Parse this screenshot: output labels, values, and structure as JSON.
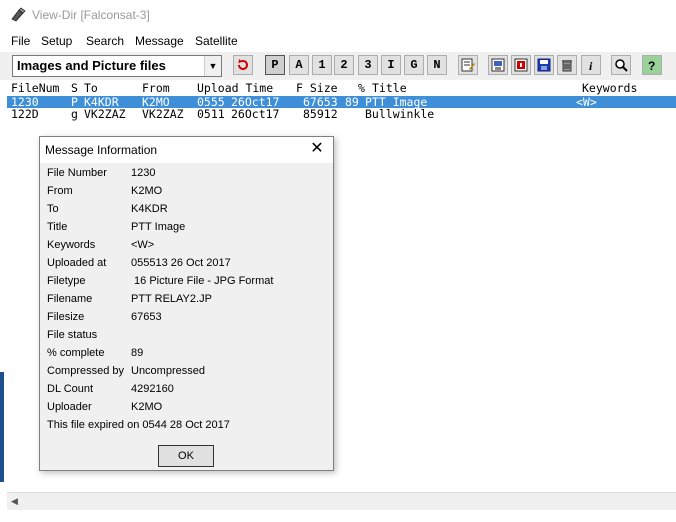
{
  "window": {
    "title": "View-Dir [Falconsat-3]"
  },
  "menu": [
    "File",
    "Setup",
    "Search",
    "Message",
    "Satellite"
  ],
  "toolbar": {
    "filter_value": "Images and Picture files",
    "letter_buttons": [
      "P",
      "A",
      "1",
      "2",
      "3",
      "I",
      "G",
      "N"
    ]
  },
  "columns": {
    "filenum": "FileNum",
    "s": "S",
    "to": "To",
    "from": "From",
    "upload_time": "Upload Time",
    "fsize": "F Size",
    "pct": "%",
    "title": "Title",
    "keywords": "Keywords"
  },
  "rows": [
    {
      "filenum": "1230",
      "s": "P",
      "to": "K4KDR",
      "from": "K2MO",
      "time": "0555",
      "date": "26Oct17",
      "size": "67653",
      "pct": "89",
      "title": "PTT Image",
      "keywords": "<W>",
      "selected": true
    },
    {
      "filenum": "122D",
      "s": "g",
      "to": "VK2ZAZ",
      "from": "VK2ZAZ",
      "time": "0511",
      "date": "26Oct17",
      "size": "85912",
      "pct": "",
      "title": "Bullwinkle",
      "keywords": "",
      "selected": false
    }
  ],
  "dialog": {
    "title": "Message Information",
    "fields": [
      {
        "label": "File Number",
        "value": "1230"
      },
      {
        "label": "From",
        "value": "K2MO"
      },
      {
        "label": "To",
        "value": "K4KDR"
      },
      {
        "label": "Title",
        "value": "PTT Image"
      },
      {
        "label": "Keywords",
        "value": "<W>"
      },
      {
        "label": "Uploaded at",
        "value": "055513 26 Oct 2017"
      },
      {
        "label": "Filetype",
        "value": " 16 Picture File - JPG Format"
      },
      {
        "label": "Filename",
        "value": "PTT RELAY2.JP"
      },
      {
        "label": "Filesize",
        "value": "67653"
      },
      {
        "label": "File status",
        "value": ""
      },
      {
        "label": "% complete",
        "value": "89"
      },
      {
        "label": "Compressed by",
        "value": "Uncompressed"
      },
      {
        "label": "DL Count",
        "value": "4292160"
      },
      {
        "label": "Uploader",
        "value": "K2MO"
      }
    ],
    "expiry_text": "This file expired on 0544 28 Oct 2017",
    "ok_label": "OK",
    "close_glyph": "✕"
  }
}
